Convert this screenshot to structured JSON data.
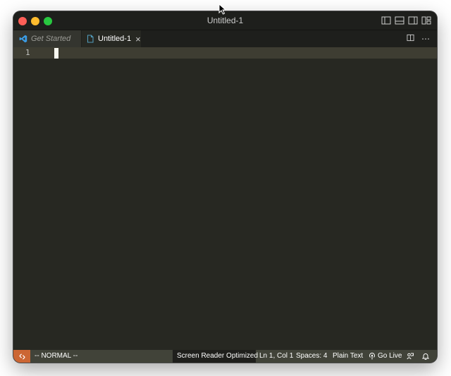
{
  "window": {
    "title": "Untitled-1",
    "layout_icons": [
      "toggle-primary-sidebar-icon",
      "toggle-panel-icon",
      "toggle-secondary-sidebar-icon",
      "customize-layout-icon"
    ]
  },
  "tabs": [
    {
      "label": "Get Started",
      "icon": "vscode-logo-icon",
      "active": false
    },
    {
      "label": "Untitled-1",
      "icon": "file-icon",
      "active": true,
      "close": "×"
    }
  ],
  "tab_actions": {
    "split": "split-editor-icon",
    "more": "⋯"
  },
  "editor": {
    "line_numbers": [
      "1"
    ]
  },
  "statusbar": {
    "remote_icon": "remote-icon",
    "vim_mode": "-- NORMAL --",
    "screen_reader": "Screen Reader Optimized",
    "cursor_position": "Ln 1, Col 1",
    "indentation": "Spaces: 4",
    "language": "Plain Text",
    "go_live": "Go Live",
    "feedback_icon": "feedback-icon",
    "notifications_icon": "bell-icon"
  },
  "colors": {
    "editor_bg": "#272822",
    "titlebar_bg": "#1e1f1c",
    "statusbar_bg": "#414339",
    "remote_accent": "#cc6633"
  }
}
